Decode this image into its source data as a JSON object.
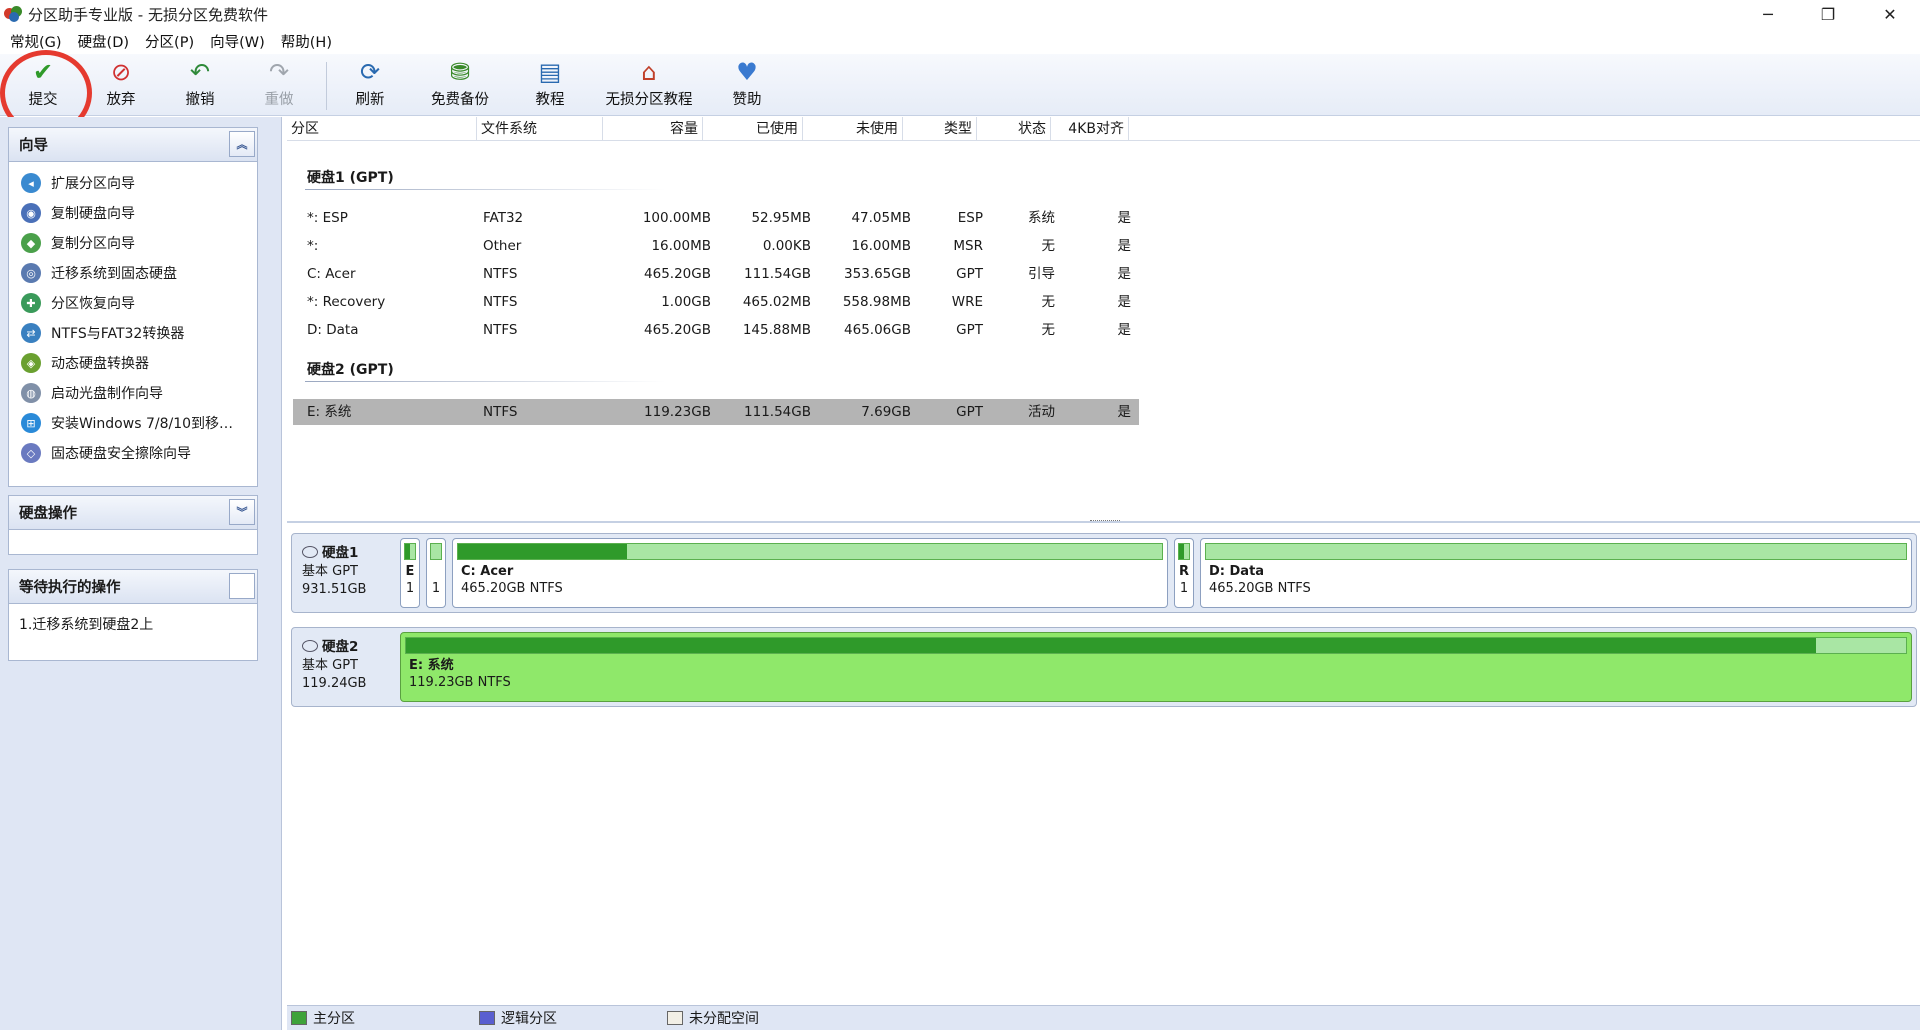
{
  "window": {
    "title": "分区助手专业版 - 无损分区免费软件",
    "controls": [
      "─",
      "❐",
      "✕"
    ]
  },
  "menu": [
    "常规(G)",
    "硬盘(D)",
    "分区(P)",
    "向导(W)",
    "帮助(H)"
  ],
  "toolbar": {
    "commit": "提交",
    "discard": "放弃",
    "undo": "撤销",
    "redo": "重做",
    "refresh": "刷新",
    "backup": "免费备份",
    "tutorial": "教程",
    "lossless_tutorial": "无损分区教程",
    "donate": "赞助"
  },
  "sidebar": {
    "wizard_title": "向导",
    "wizard_items": [
      "扩展分区向导",
      "复制硬盘向导",
      "复制分区向导",
      "迁移系统到固态硬盘",
      "分区恢复向导",
      "NTFS与FAT32转换器",
      "动态硬盘转换器",
      "启动光盘制作向导",
      "安装Windows 7/8/10到移…",
      "固态硬盘安全擦除向导"
    ],
    "disk_ops_title": "硬盘操作",
    "pending_title": "等待执行的操作",
    "pending_items": [
      "1.迁移系统到硬盘2上"
    ]
  },
  "table": {
    "headers": [
      "分区",
      "文件系统",
      "容量",
      "已使用",
      "未使用",
      "类型",
      "状态",
      "4KB对齐"
    ],
    "disk1_title": "硬盘1 (GPT)",
    "disk2_title": "硬盘2 (GPT)",
    "disk1_rows": [
      [
        "*: ESP",
        "FAT32",
        "100.00MB",
        "52.95MB",
        "47.05MB",
        "ESP",
        "系统",
        "是"
      ],
      [
        "*:",
        "Other",
        "16.00MB",
        "0.00KB",
        "16.00MB",
        "MSR",
        "无",
        "是"
      ],
      [
        "C: Acer",
        "NTFS",
        "465.20GB",
        "111.54GB",
        "353.65GB",
        "GPT",
        "引导",
        "是"
      ],
      [
        "*: Recovery",
        "NTFS",
        "1.00GB",
        "465.02MB",
        "558.98MB",
        "WRE",
        "无",
        "是"
      ],
      [
        "D: Data",
        "NTFS",
        "465.20GB",
        "145.88MB",
        "465.06GB",
        "GPT",
        "无",
        "是"
      ]
    ],
    "disk2_rows": [
      [
        "E: 系统",
        "NTFS",
        "119.23GB",
        "111.54GB",
        "7.69GB",
        "GPT",
        "活动",
        "是"
      ]
    ]
  },
  "diskmap": {
    "disk1": {
      "name": "硬盘1",
      "type": "基本 GPT",
      "size": "931.51GB",
      "parts": [
        {
          "letter": "E",
          "num": "1",
          "used": 0.53
        },
        {
          "letter": "",
          "num": "1",
          "used": 0.0
        },
        {
          "title": "C: Acer",
          "sub": "465.20GB NTFS",
          "used": 0.24
        },
        {
          "letter": "R",
          "num": "1",
          "used": 0.45
        },
        {
          "title": "D: Data",
          "sub": "465.20GB NTFS",
          "used": 0.0
        }
      ]
    },
    "disk2": {
      "name": "硬盘2",
      "type": "基本 GPT",
      "size": "119.24GB",
      "part": {
        "title": "E: 系统",
        "sub": "119.23GB NTFS",
        "used": 0.94
      }
    }
  },
  "legend": [
    "主分区",
    "逻辑分区",
    "未分配空间"
  ],
  "colors": {
    "primary": "#3fa33a",
    "logical": "#5a5fd0",
    "unallocated": "#f2efe6",
    "highlight": "#e53a2f"
  }
}
